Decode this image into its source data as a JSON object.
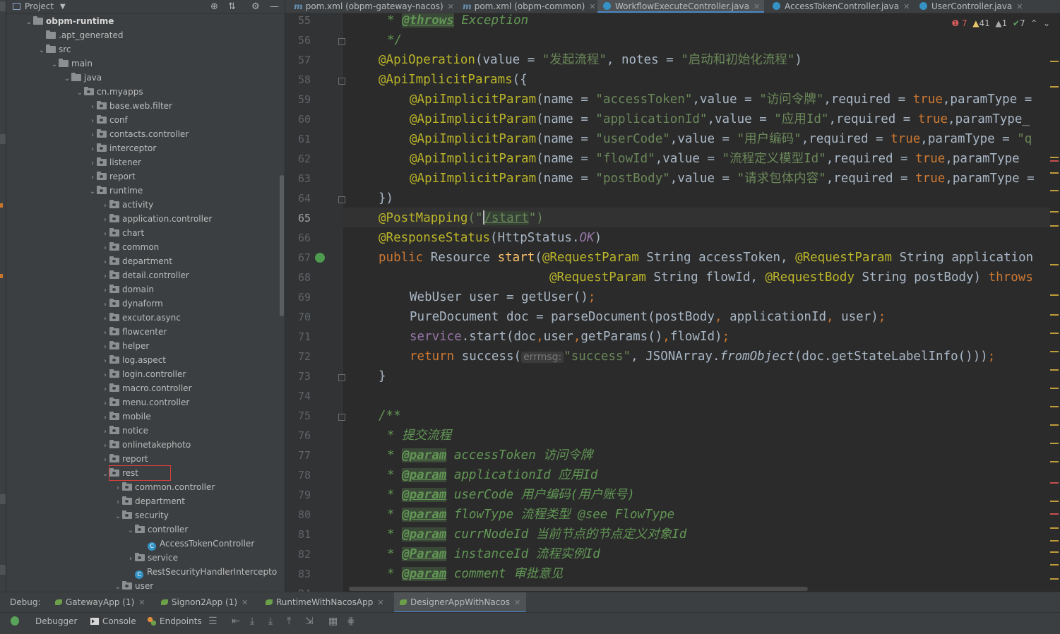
{
  "project": {
    "title": "Project",
    "tree": [
      {
        "label": "obpm-runtime",
        "depth": 1,
        "open": true,
        "kind": "module"
      },
      {
        "label": ".apt_generated",
        "depth": 2,
        "open": null,
        "kind": "folder"
      },
      {
        "label": "src",
        "depth": 2,
        "open": true,
        "kind": "folder"
      },
      {
        "label": "main",
        "depth": 3,
        "open": true,
        "kind": "folder"
      },
      {
        "label": "java",
        "depth": 4,
        "open": true,
        "kind": "folder"
      },
      {
        "label": "cn.myapps",
        "depth": 5,
        "open": true,
        "kind": "pkg"
      },
      {
        "label": "base.web.filter",
        "depth": 6,
        "open": false,
        "kind": "pkg"
      },
      {
        "label": "conf",
        "depth": 6,
        "open": false,
        "kind": "pkg"
      },
      {
        "label": "contacts.controller",
        "depth": 6,
        "open": false,
        "kind": "pkg"
      },
      {
        "label": "interceptor",
        "depth": 6,
        "open": false,
        "kind": "pkg"
      },
      {
        "label": "listener",
        "depth": 6,
        "open": false,
        "kind": "pkg"
      },
      {
        "label": "report",
        "depth": 6,
        "open": false,
        "kind": "pkg"
      },
      {
        "label": "runtime",
        "depth": 6,
        "open": true,
        "kind": "pkg"
      },
      {
        "label": "activity",
        "depth": 7,
        "open": false,
        "kind": "pkg"
      },
      {
        "label": "application.controller",
        "depth": 7,
        "open": false,
        "kind": "pkg"
      },
      {
        "label": "chart",
        "depth": 7,
        "open": false,
        "kind": "pkg"
      },
      {
        "label": "common",
        "depth": 7,
        "open": false,
        "kind": "pkg"
      },
      {
        "label": "department",
        "depth": 7,
        "open": false,
        "kind": "pkg"
      },
      {
        "label": "detail.controller",
        "depth": 7,
        "open": false,
        "kind": "pkg"
      },
      {
        "label": "domain",
        "depth": 7,
        "open": false,
        "kind": "pkg"
      },
      {
        "label": "dynaform",
        "depth": 7,
        "open": false,
        "kind": "pkg"
      },
      {
        "label": "excutor.async",
        "depth": 7,
        "open": false,
        "kind": "pkg"
      },
      {
        "label": "flowcenter",
        "depth": 7,
        "open": false,
        "kind": "pkg"
      },
      {
        "label": "helper",
        "depth": 7,
        "open": false,
        "kind": "pkg"
      },
      {
        "label": "log.aspect",
        "depth": 7,
        "open": false,
        "kind": "pkg"
      },
      {
        "label": "login.controller",
        "depth": 7,
        "open": false,
        "kind": "pkg"
      },
      {
        "label": "macro.controller",
        "depth": 7,
        "open": false,
        "kind": "pkg"
      },
      {
        "label": "menu.controller",
        "depth": 7,
        "open": false,
        "kind": "pkg"
      },
      {
        "label": "mobile",
        "depth": 7,
        "open": false,
        "kind": "pkg"
      },
      {
        "label": "notice",
        "depth": 7,
        "open": false,
        "kind": "pkg"
      },
      {
        "label": "onlinetakephoto",
        "depth": 7,
        "open": false,
        "kind": "pkg"
      },
      {
        "label": "report",
        "depth": 7,
        "open": false,
        "kind": "pkg"
      },
      {
        "label": "rest",
        "depth": 7,
        "open": true,
        "kind": "pkg"
      },
      {
        "label": "common.controller",
        "depth": 8,
        "open": false,
        "kind": "pkg"
      },
      {
        "label": "department",
        "depth": 8,
        "open": false,
        "kind": "pkg"
      },
      {
        "label": "security",
        "depth": 8,
        "open": true,
        "kind": "pkg"
      },
      {
        "label": "controller",
        "depth": 9,
        "open": true,
        "kind": "pkg"
      },
      {
        "label": "AccessTokenController",
        "depth": 10,
        "open": null,
        "kind": "class"
      },
      {
        "label": "service",
        "depth": 9,
        "open": false,
        "kind": "pkg"
      },
      {
        "label": "RestSecurityHandlerIntercepto",
        "depth": 9,
        "open": null,
        "kind": "class"
      },
      {
        "label": "user",
        "depth": 8,
        "open": true,
        "kind": "pkg"
      }
    ]
  },
  "tabs": [
    {
      "label": "pom.xml (obpm-gateway-nacos)",
      "icon": "m"
    },
    {
      "label": "pom.xml (obpm-common)",
      "icon": "m"
    },
    {
      "label": "WorkflowExecuteController.java",
      "icon": "c",
      "active": true
    },
    {
      "label": "AccessTokenController.java",
      "icon": "c"
    },
    {
      "label": "UserController.java",
      "icon": "c"
    }
  ],
  "inspections": {
    "errors": "7",
    "warnings": "41",
    "weak": "1",
    "ok": "7"
  },
  "editor": {
    "current_line": "65",
    "lines": [
      "55",
      "56",
      "57",
      "58",
      "59",
      "60",
      "61",
      "62",
      "63",
      "64",
      "65",
      "66",
      "67",
      "68",
      "69",
      "70",
      "71",
      "72",
      "73",
      "74",
      "75",
      "76",
      "77",
      "78",
      "79",
      "80",
      "81",
      "82",
      "83",
      "84"
    ],
    "code": {
      "l55": [
        "* ",
        "@throws",
        " Exception"
      ],
      "l56": [
        "*/"
      ],
      "l57": [
        "@ApiOperation",
        "(value = ",
        "\"发起流程\"",
        ", notes = ",
        "\"启动和初始化流程\"",
        ")"
      ],
      "l58": [
        "@ApiImplicitParams",
        "({"
      ],
      "l59": [
        "@ApiImplicitParam",
        "(name = ",
        "\"accessToken\"",
        ",value = ",
        "\"访问令牌\"",
        ",required = ",
        "true",
        ",paramType = "
      ],
      "l60": [
        "@ApiImplicitParam",
        "(name = ",
        "\"applicationId\"",
        ",value = ",
        "\"应用Id\"",
        ",required = ",
        "true",
        ",paramType_"
      ],
      "l61": [
        "@ApiImplicitParam",
        "(name = ",
        "\"userCode\"",
        ",value = ",
        "\"用户编码\"",
        ",required = ",
        "true",
        ",paramType = ",
        "\"q"
      ],
      "l62": [
        "@ApiImplicitParam",
        "(name = ",
        "\"flowId\"",
        ",value = ",
        "\"流程定义模型Id\"",
        ",required = ",
        "true",
        ",paramType"
      ],
      "l63": [
        "@ApiImplicitParam",
        "(name = ",
        "\"postBody\"",
        ",value = ",
        "\"请求包体内容\"",
        ",required = ",
        "true",
        ",paramType ="
      ],
      "l64": [
        "})"
      ],
      "l65": [
        "@PostMapping",
        "(\"",
        "/start",
        "\")"
      ],
      "l66": [
        "@ResponseStatus",
        "(HttpStatus.",
        "OK",
        ")"
      ],
      "l67": [
        "public ",
        "Resource ",
        "start",
        "(",
        "@RequestParam",
        " String accessToken, ",
        "@RequestParam",
        " String application"
      ],
      "l68": [
        "@RequestParam",
        " String flowId, ",
        "@RequestBody",
        " String postBody) ",
        "throws"
      ],
      "l69": [
        "WebUser user = getUser()",
        ";"
      ],
      "l70": [
        "PureDocument doc = parseDocument(postBody",
        ", ",
        "applicationId",
        ", ",
        "user)",
        ";"
      ],
      "l71": [
        "service",
        ".start(doc",
        ",",
        "user",
        ",",
        "getParams()",
        ",",
        "flowId)",
        ";"
      ],
      "l72": [
        "return ",
        "success(",
        "errmsg:",
        "\"success\"",
        ", JSONArray.",
        "fromObject",
        "(doc.getStateLabelInfo()))",
        ";"
      ],
      "l73": [
        "}"
      ],
      "l75": [
        "/**"
      ],
      "l76": [
        "* 提交流程"
      ],
      "l77": [
        "* ",
        "@param",
        " accessToken ",
        "访问令牌"
      ],
      "l78": [
        "* ",
        "@param",
        " applicationId ",
        "应用Id"
      ],
      "l79": [
        "* ",
        "@param",
        " userCode ",
        "用户编码(用户账号)"
      ],
      "l80": [
        "* ",
        "@param",
        " flowType ",
        "流程类型 ",
        "@see",
        " FlowType"
      ],
      "l81": [
        "* ",
        "@param",
        " currNodeId ",
        "当前节点的节点定义对象Id"
      ],
      "l82": [
        "* ",
        "@Param",
        " instanceId ",
        "流程实例Id"
      ],
      "l83": [
        "* ",
        "@param",
        " comment ",
        "审批意见"
      ]
    }
  },
  "debug": {
    "label": "Debug:",
    "sessions": [
      {
        "label": "GatewayApp (1)"
      },
      {
        "label": "Signon2App (1)"
      },
      {
        "label": "RuntimeWithNacosApp"
      },
      {
        "label": "DesignerAppWithNacos",
        "active": true
      }
    ],
    "toolbar": {
      "debugger": "Debugger",
      "console": "Console",
      "endpoints": "Endpoints"
    }
  }
}
